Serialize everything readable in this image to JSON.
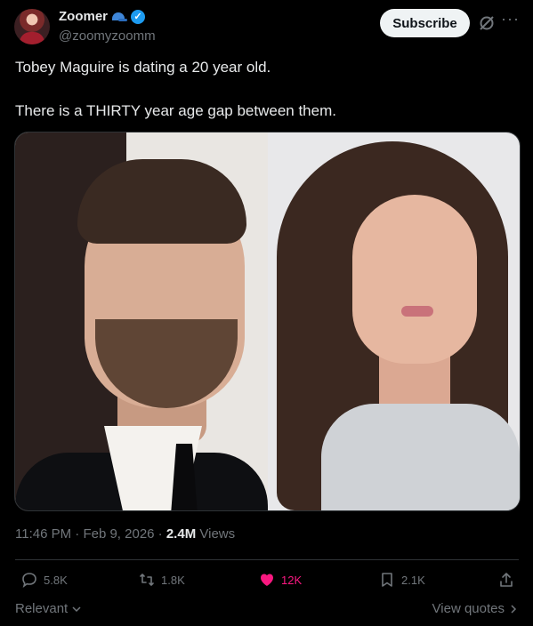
{
  "author": {
    "display_name": "Zoomer",
    "handle": "@zoomyzoomm",
    "avatar_icon": "user-avatar"
  },
  "header": {
    "subscribe_label": "Subscribe",
    "grok_icon": "grok-icon",
    "more_icon": "more-icon"
  },
  "post": {
    "line1": "Tobey Maguire is dating a 20 year old.",
    "line2": "There is a THIRTY year age gap between them."
  },
  "media": {
    "left_photo": "man-portrait",
    "right_photo": "woman-portrait"
  },
  "meta": {
    "time": "11:46 PM",
    "date": "Feb 9, 2026",
    "views_count": "2.4M",
    "views_label": "Views",
    "separator": "·"
  },
  "actions": {
    "replies": "5.8K",
    "reposts": "1.8K",
    "likes": "12K",
    "bookmarks": "2.1K"
  },
  "footer": {
    "relevant_label": "Relevant",
    "view_quotes_label": "View quotes"
  },
  "colors": {
    "background": "#000000",
    "text": "#e7e9ea",
    "muted": "#71767b",
    "like": "#f91880",
    "verified": "#1d9bf0"
  }
}
